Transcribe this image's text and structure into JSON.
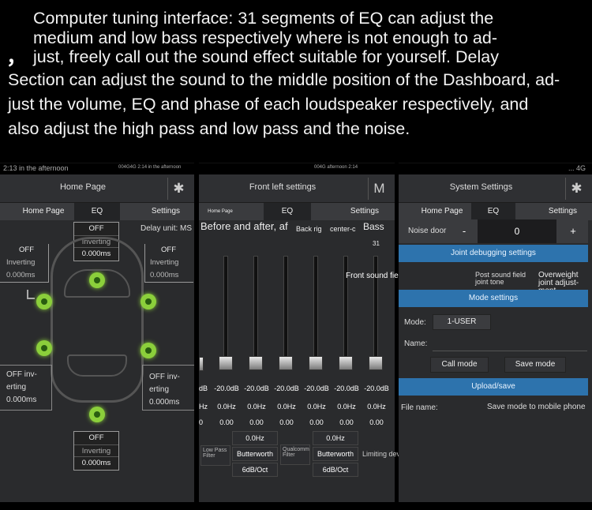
{
  "caption": {
    "line1": "Computer tuning interface: 31 segments of EQ can adjust the",
    "line2": "medium and low bass respectively where is not enough to ad-",
    "line3": "just, freely call out the sound effect suitable for yourself. Delay",
    "line4": "Section can adjust the sound to the middle position of the Dashboard, ad-",
    "line5": "just the volume, EQ and phase of each loudspeaker respectively, and",
    "line6": "also adjust the high pass and low pass and the noise.",
    "bullet": "，"
  },
  "screen1": {
    "status_time": "2:13 in the afternoon",
    "status_small": "004G4G 2:14 in the afternoon",
    "title": "Home Page",
    "tabs": [
      "Home Page",
      "EQ",
      "Settings"
    ],
    "delay_unit": "Delay unit: MS",
    "top_center": {
      "state": "OFF",
      "mode": "Inverting",
      "value": "0.000ms"
    },
    "top_left": {
      "state": "OFF",
      "mode": "Inverting",
      "value": "0.000ms"
    },
    "top_right": {
      "state": "OFF",
      "mode": "Inverting",
      "value": "0.000ms"
    },
    "mid_left": {
      "state": "OFF inv-",
      "mode": "erting",
      "value": "0.000ms"
    },
    "mid_right": {
      "state": "OFF inv-",
      "mode": "erting",
      "value": "0.000ms"
    },
    "bottom": {
      "state": "OFF",
      "mode": "Inverting",
      "value": "0.000ms"
    }
  },
  "screen2": {
    "status_small": "004G afternoon 2:14",
    "title": "Front left settings",
    "icon_letter": "M",
    "tabs": [
      "Home Page",
      "EQ",
      "Settings"
    ],
    "overlay_text": "Before and after, af",
    "back_label": "Back rig",
    "center_label": "center-c",
    "bass_label": "Bass",
    "band_count": "31",
    "joint_label": "Front sound field joint adjustment",
    "gains": [
      "dB",
      "-20.0dB",
      "-20.0dB",
      "-20.0dB",
      "-20.0dB",
      "-20.0dB",
      "-20.0dB"
    ],
    "freqs": [
      "Hz",
      "0.0Hz",
      "0.0Hz",
      "0.0Hz",
      "0.0Hz",
      "0.0Hz",
      "0.0Hz"
    ],
    "qs": [
      "0",
      "0.00",
      "0.00",
      "0.00",
      "0.00",
      "0.00",
      "0.00"
    ],
    "low_pass": "Low Pass Filter",
    "lp_freq": "0.0Hz",
    "lp_type": "Butterworth",
    "lp_slope": "6dB/Oct",
    "qualcomm": "Qualcomm Filter",
    "hp_freq": "0.0Hz",
    "hp_type": "Butterworth",
    "hp_slope": "6dB/Oct",
    "limiter": "Limiting device"
  },
  "screen3": {
    "status_icons": "... 4G",
    "title": "System Settings",
    "tabs": [
      "Home Page",
      "EQ",
      "Settings"
    ],
    "noise_label": "Noise door",
    "minus": "-",
    "noise_value": "0",
    "plus": "+",
    "joint_debug": "Joint debugging settings",
    "post_sound": "Post sound field joint tone",
    "overweight": "Overweight joint adjust-ment",
    "mode_settings": "Mode settings",
    "mode_label": "Mode:",
    "mode_value": "1-USER",
    "name_label": "Name:",
    "call_mode": "Call mode",
    "save_mode": "Save mode",
    "upload_save": "Upload/save",
    "file_name": "File name:",
    "save_mobile": "Save mode to mobile phone"
  }
}
